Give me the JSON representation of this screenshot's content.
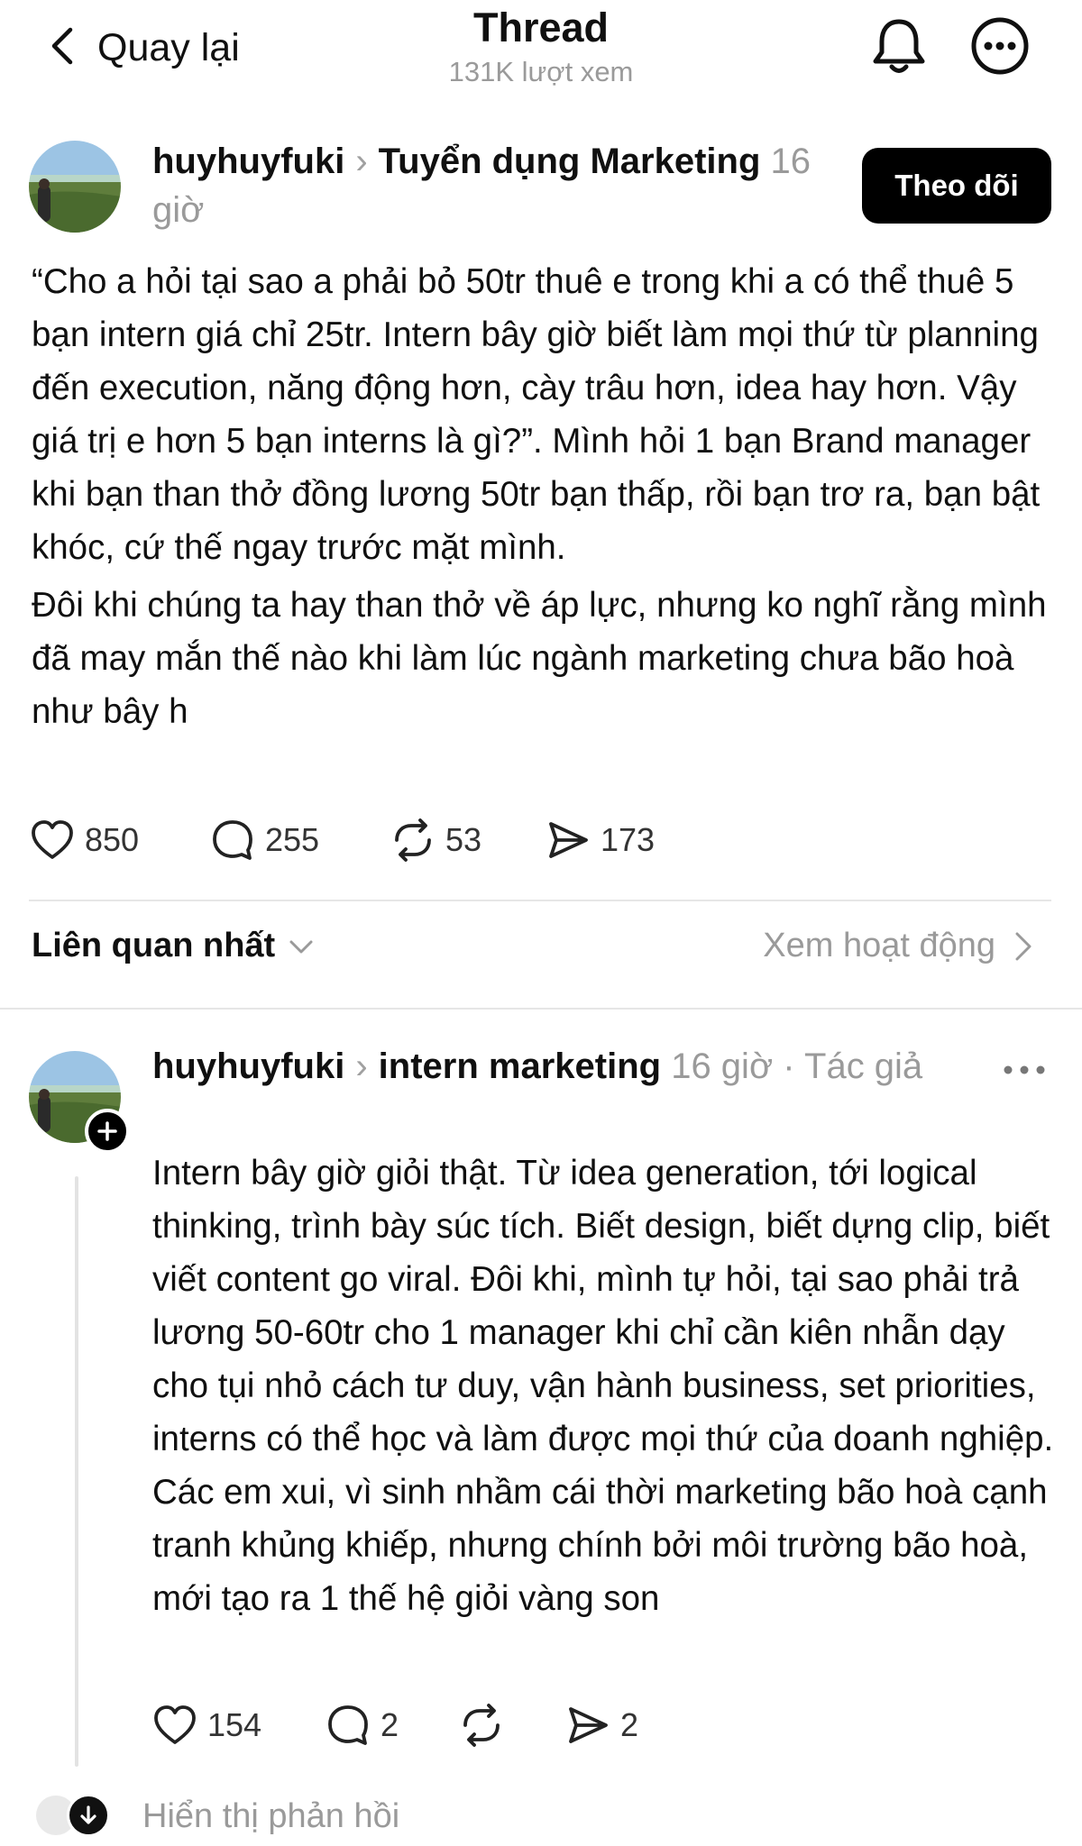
{
  "colors": {
    "text": "#101010",
    "muted": "#9a9a9a",
    "button_bg": "#000000",
    "button_text": "#ffffff",
    "divider": "#e6e6e6"
  },
  "header": {
    "back_label": "Quay lại",
    "title": "Thread",
    "views": "131K lượt xem",
    "icons": [
      "chevron-left-icon",
      "bell-icon",
      "more-circle-icon"
    ]
  },
  "post": {
    "username": "huyhuyfuki",
    "topic": "Tuyển dụng Marketing",
    "time": "16 giờ",
    "follow_label": "Theo dõi",
    "paragraphs": [
      "“Cho a hỏi tại sao a phải bỏ 50tr thuê e trong khi a có thể thuê 5 bạn intern giá chỉ 25tr. Intern bây giờ biết làm mọi thứ từ planning đến execution, năng động hơn, cày trâu hơn, idea hay hơn. Vậy giá trị e hơn 5 bạn interns là gì?”. Mình hỏi 1 bạn Brand manager khi bạn than thở đồng lương 50tr bạn thấp, rồi bạn trơ ra, bạn bật khóc, cứ thế ngay trước mặt mình.",
      "Đôi khi chúng ta hay than thở về áp lực, nhưng ko nghĩ rằng mình đã may mắn thế nào khi làm lúc ngành marketing chưa bão hoà như bây h"
    ],
    "likes": "850",
    "comments": "255",
    "reposts": "53",
    "shares": "173"
  },
  "sort": {
    "label": "Liên quan nhất",
    "activity_label": "Xem hoạt động"
  },
  "reply": {
    "username": "huyhuyfuki",
    "topic": "intern marketing",
    "time": "16 giờ",
    "tag": "· Tác giả",
    "body": "Intern bây giờ giỏi thật. Từ idea generation, tới logical thinking, trình bày súc tích. Biết design, biết dựng clip, biết viết content go viral. Đôi khi, mình tự hỏi, tại sao phải trả lương 50-60tr cho 1 manager khi chỉ cần kiên nhẫn dạy cho tụi nhỏ cách tư duy, vận hành business, set priorities, interns có thể học và làm được mọi thứ của doanh nghiệp. Các em xui, vì sinh nhầm cái thời marketing bão hoà cạnh tranh khủng khiếp, nhưng chính bởi môi trường bão hoà, mới tạo ra 1 thế hệ giỏi vàng son",
    "likes": "154",
    "comments": "2",
    "shares": "2",
    "show_replies_label": "Hiển thị phản hồi"
  }
}
